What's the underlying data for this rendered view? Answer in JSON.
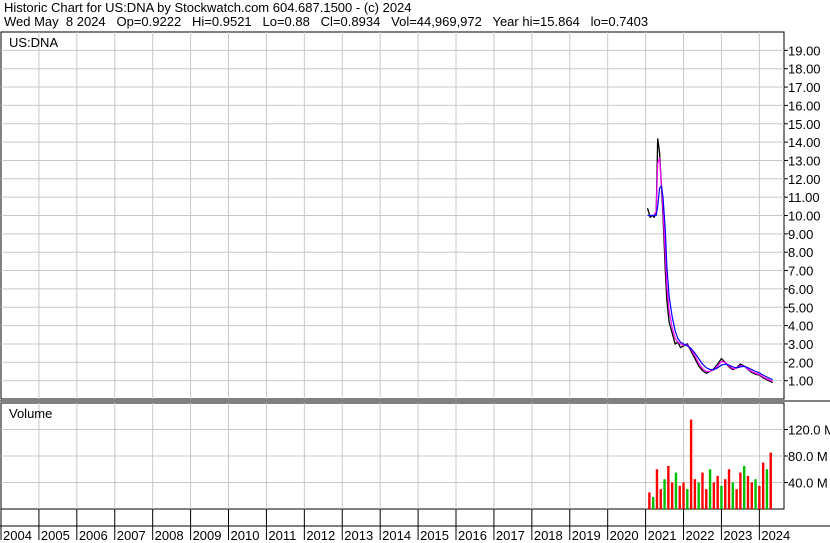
{
  "header": {
    "line1": "Historic Chart for US:DNA by Stockwatch.com 604.687.1500 - (c) 2024",
    "line2": "Wed May  8 2024   Op=0.9222   Hi=0.9521   Lo=0.88   Cl=0.8934   Vol=44,969,972   Year hi=15.864   lo=0.7403"
  },
  "colors": {
    "price": "#000000",
    "ma_short": "#ff00ff",
    "ma_long": "#0000ff",
    "volume_up": "#00c000",
    "volume_down": "#ff0000",
    "grid": "#c8c8c8"
  },
  "chart_data": [
    {
      "type": "line",
      "label": "US:DNA",
      "ylim": [
        0,
        20
      ],
      "yticks": [
        "1.00",
        "2.00",
        "3.00",
        "4.00",
        "5.00",
        "6.00",
        "7.00",
        "8.00",
        "9.00",
        "10.00",
        "11.00",
        "12.00",
        "13.00",
        "14.00",
        "15.00",
        "16.00",
        "17.00",
        "18.00",
        "19.00"
      ],
      "x": [
        2021.05,
        2021.12,
        2021.18,
        2021.22,
        2021.28,
        2021.32,
        2021.37,
        2021.42,
        2021.46,
        2021.52,
        2021.56,
        2021.62,
        2021.7,
        2021.78,
        2021.85,
        2021.92,
        2022.0,
        2022.1,
        2022.2,
        2022.3,
        2022.4,
        2022.5,
        2022.6,
        2022.7,
        2022.8,
        2022.9,
        2023.0,
        2023.1,
        2023.2,
        2023.3,
        2023.4,
        2023.5,
        2023.6,
        2023.7,
        2023.8,
        2023.9,
        2024.0,
        2024.1,
        2024.2,
        2024.3,
        2024.35
      ],
      "series": [
        {
          "values": [
            10.4,
            9.9,
            10.0,
            9.9,
            10.1,
            14.2,
            13.4,
            11.5,
            10.0,
            7.0,
            5.4,
            4.2,
            3.6,
            3.0,
            3.1,
            2.8,
            2.9,
            3.0,
            2.6,
            2.2,
            1.8,
            1.55,
            1.4,
            1.5,
            1.65,
            1.9,
            2.2,
            2.0,
            1.75,
            1.6,
            1.7,
            1.9,
            1.8,
            1.6,
            1.45,
            1.35,
            1.3,
            1.15,
            1.05,
            0.95,
            0.89
          ]
        },
        {
          "values": [
            10.0,
            10.0,
            10.0,
            10.0,
            10.2,
            12.9,
            13.1,
            11.6,
            10.4,
            7.8,
            6.2,
            4.8,
            3.9,
            3.3,
            3.1,
            3.0,
            2.95,
            2.95,
            2.7,
            2.35,
            1.95,
            1.65,
            1.5,
            1.5,
            1.6,
            1.8,
            2.05,
            2.0,
            1.8,
            1.65,
            1.68,
            1.82,
            1.78,
            1.62,
            1.5,
            1.4,
            1.33,
            1.2,
            1.1,
            1.0,
            0.95
          ]
        },
        {
          "values": [
            10.0,
            10.0,
            10.0,
            10.0,
            10.0,
            10.5,
            11.5,
            11.6,
            11.0,
            9.2,
            7.3,
            5.6,
            4.5,
            3.7,
            3.3,
            3.1,
            3.0,
            2.9,
            2.75,
            2.5,
            2.2,
            1.9,
            1.7,
            1.6,
            1.6,
            1.7,
            1.85,
            1.9,
            1.85,
            1.75,
            1.7,
            1.75,
            1.78,
            1.7,
            1.6,
            1.5,
            1.42,
            1.3,
            1.2,
            1.1,
            1.05
          ]
        }
      ]
    },
    {
      "type": "bar",
      "label": "Volume",
      "ylim": [
        0,
        160
      ],
      "yticks": [
        "40.0 M",
        "80.0 M",
        "120.0 M"
      ],
      "x": [
        2021.1,
        2021.2,
        2021.3,
        2021.4,
        2021.5,
        2021.6,
        2021.7,
        2021.8,
        2021.9,
        2022.0,
        2022.1,
        2022.2,
        2022.3,
        2022.4,
        2022.5,
        2022.6,
        2022.7,
        2022.8,
        2022.9,
        2023.0,
        2023.1,
        2023.2,
        2023.3,
        2023.4,
        2023.5,
        2023.6,
        2023.7,
        2023.8,
        2023.9,
        2024.0,
        2024.1,
        2024.2,
        2024.3
      ],
      "series": [
        {
          "values": [
            25,
            18,
            60,
            30,
            45,
            65,
            40,
            55,
            35,
            40,
            30,
            135,
            45,
            40,
            55,
            30,
            60,
            40,
            50,
            35,
            45,
            60,
            40,
            30,
            55,
            65,
            50,
            40,
            45,
            35,
            70,
            60,
            85
          ]
        }
      ]
    }
  ],
  "x_axis": {
    "labels": [
      "2004",
      "2005",
      "2006",
      "2007",
      "2008",
      "2009",
      "2010",
      "2011",
      "2012",
      "2013",
      "2014",
      "2015",
      "2016",
      "2017",
      "2018",
      "2019",
      "2020",
      "2021",
      "2022",
      "2023",
      "2024"
    ]
  }
}
